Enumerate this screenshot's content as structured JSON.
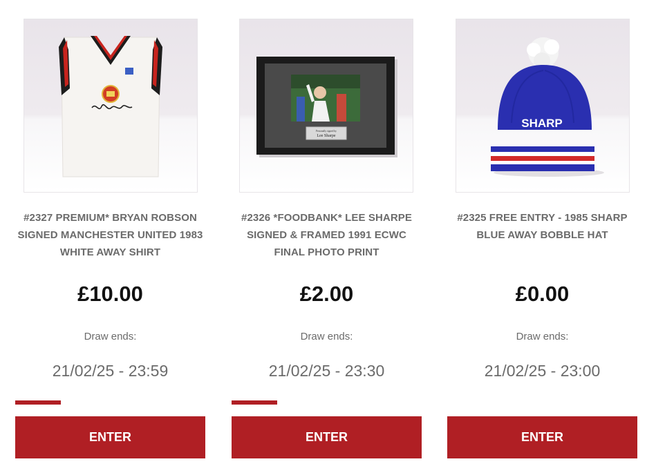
{
  "colors": {
    "accent": "#b01f24",
    "text_muted": "#6b6b6b",
    "price": "#111111"
  },
  "cards": [
    {
      "title_lines": [
        "#2327 PREMIUM* BRYAN ROBSON",
        "SIGNED MANCHESTER UNITED 1983",
        "WHITE AWAY SHIRT"
      ],
      "price": "£10.00",
      "draw_label": "Draw ends:",
      "draw_date": "21/02/25 - 23:59",
      "sold_fraction": 0.24,
      "button_label": "ENTER"
    },
    {
      "title_lines": [
        "#2326 *FOODBANK* LEE SHARPE",
        "SIGNED & FRAMED 1991 ECWC",
        "FINAL PHOTO PRINT"
      ],
      "price": "£2.00",
      "draw_label": "Draw ends:",
      "draw_date": "21/02/25 - 23:30",
      "sold_fraction": 0.24,
      "button_label": "ENTER"
    },
    {
      "title_lines": [
        "#2325 FREE ENTRY - 1985 SHARP",
        "BLUE AWAY BOBBLE HAT"
      ],
      "price": "£0.00",
      "draw_label": "Draw ends:",
      "draw_date": "21/02/25 - 23:00",
      "sold_fraction": 0,
      "button_label": "ENTER"
    }
  ],
  "images": {
    "frame_plaque_small": "Personally signed by",
    "frame_plaque_name": "Lee Sharpe",
    "hat_text": "SHARP"
  }
}
